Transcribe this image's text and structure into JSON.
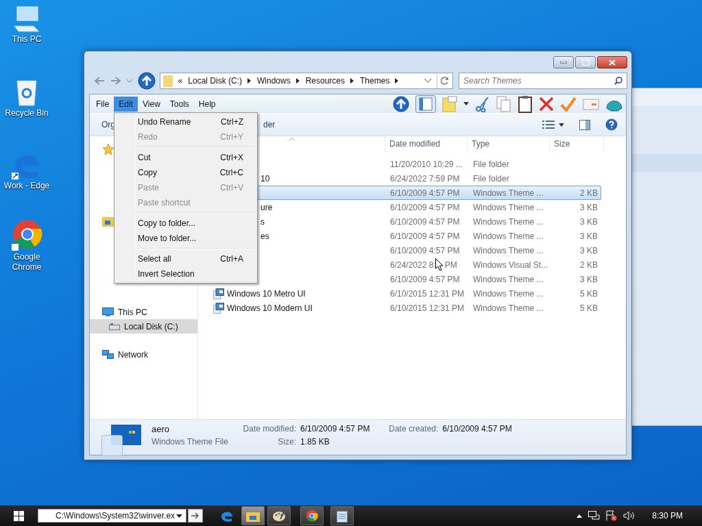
{
  "desktop_icons": [
    {
      "kind": "pc",
      "label": "This PC"
    },
    {
      "kind": "bin",
      "label": "Recycle Bin"
    },
    {
      "kind": "edge",
      "label": "Work - Edge"
    },
    {
      "kind": "chrome",
      "label": "Google Chrome"
    }
  ],
  "address": {
    "crumbs": [
      "«",
      "Local Disk (C:)",
      "Windows",
      "Resources",
      "Themes"
    ]
  },
  "search": {
    "placeholder": "Search Themes"
  },
  "menu_bar": [
    {
      "label": "File",
      "selected": false
    },
    {
      "label": "Edit",
      "selected": true
    },
    {
      "label": "View",
      "selected": false
    },
    {
      "label": "Tools",
      "selected": false
    },
    {
      "label": "Help",
      "selected": false
    }
  ],
  "command_bar": {
    "organize": "Org",
    "new_folder": "der"
  },
  "sidebar": [
    {
      "label": "This PC",
      "selected": false,
      "kind": "pc",
      "children": [
        {
          "label": "Local Disk (C:)",
          "selected": true,
          "kind": "disk"
        }
      ]
    },
    {
      "label": "Network",
      "selected": false,
      "kind": "network"
    }
  ],
  "columns": [
    "Date modified",
    "Type",
    "Size"
  ],
  "rows": [
    {
      "selected": false,
      "date": "11/20/2010 10:29 ...",
      "type": "File folder"
    },
    {
      "selected": false,
      "name_tail": "10",
      "date": "6/24/2022 7:59 PM",
      "type": "File folder"
    },
    {
      "selected": true,
      "date": "6/10/2009 4:57 PM",
      "type": "Windows Theme ...",
      "size": "2 KB"
    },
    {
      "selected": false,
      "name_tail": "ure",
      "date": "6/10/2009 4:57 PM",
      "type": "Windows Theme ...",
      "size": "3 KB"
    },
    {
      "selected": false,
      "name_tail": "s",
      "date": "6/10/2009 4:57 PM",
      "type": "Windows Theme ...",
      "size": "3 KB"
    },
    {
      "selected": false,
      "name_tail": "es",
      "date": "6/10/2009 4:57 PM",
      "type": "Windows Theme ...",
      "size": "3 KB"
    },
    {
      "selected": false,
      "date": "6/10/2009 4:57 PM",
      "type": "Windows Theme ...",
      "size": "3 KB"
    },
    {
      "selected": false,
      "date": "6/24/2022 8:",
      "date_after_pointer": "PM",
      "type": "Windows Visual St...",
      "size": "2 KB"
    },
    {
      "selected": false,
      "date": "6/10/2009 4:57 PM",
      "type": "Windows Theme ...",
      "size": "3 KB"
    },
    {
      "selected": false,
      "name": "Windows 10 Metro UI",
      "date": "6/10/2015 12:31 PM",
      "type": "Windows Theme ...",
      "size": "5 KB"
    },
    {
      "selected": false,
      "name": "Windows 10 Modern UI",
      "date": "6/10/2015 12:31 PM",
      "type": "Windows Theme ...",
      "size": "5 KB"
    }
  ],
  "edit_menu": [
    {
      "items": [
        {
          "label": "Undo Rename",
          "shortcut": "Ctrl+Z",
          "disabled": false
        },
        {
          "label": "Redo",
          "shortcut": "Ctrl+Y",
          "disabled": true
        }
      ]
    },
    {
      "items": [
        {
          "label": "Cut",
          "shortcut": "Ctrl+X",
          "disabled": false
        },
        {
          "label": "Copy",
          "shortcut": "Ctrl+C",
          "disabled": false
        },
        {
          "label": "Paste",
          "shortcut": "Ctrl+V",
          "disabled": true
        },
        {
          "label": "Paste shortcut",
          "disabled": true
        }
      ]
    },
    {
      "items": [
        {
          "label": "Copy to folder...",
          "disabled": false
        },
        {
          "label": "Move to folder...",
          "disabled": false
        }
      ]
    },
    {
      "items": [
        {
          "label": "Select all",
          "shortcut": "Ctrl+A",
          "disabled": false
        },
        {
          "label": "Invert Selection",
          "disabled": false
        }
      ]
    }
  ],
  "details": {
    "name": "aero",
    "type": "Windows Theme File",
    "modified_label": "Date modified:",
    "modified": "6/10/2009 4:57 PM",
    "size_label": "Size:",
    "size": "1.85 KB",
    "created_label": "Date created:",
    "created": "6/10/2009 4:57 PM"
  },
  "taskbar": {
    "run_box": "C:\\Windows\\System32\\winver.ex",
    "apps": [
      {
        "kind": "edge",
        "selected": false
      },
      {
        "kind": "explorer",
        "selected": true
      },
      {
        "kind": "paint",
        "selected": false
      },
      {
        "kind": "chrome",
        "selected": false
      },
      {
        "kind": "notepad",
        "selected": false
      }
    ],
    "clock": "8:30 PM"
  }
}
